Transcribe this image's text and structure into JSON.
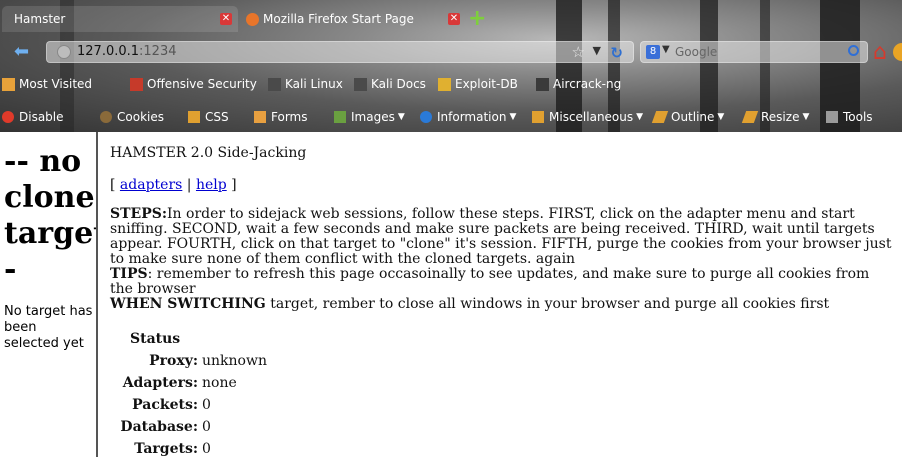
{
  "tabs": [
    {
      "label": "Hamster",
      "active": true
    },
    {
      "label": "Mozilla Firefox Start Page",
      "active": false
    }
  ],
  "navbar": {
    "url_host": "127.0.0.1",
    "url_port": ":1234",
    "search_placeholder": "Google"
  },
  "bookmarks": [
    {
      "label": "Most Visited",
      "icon": "folder-icon"
    },
    {
      "label": "Offensive Security",
      "icon": "offsec-icon"
    },
    {
      "label": "Kali Linux",
      "icon": "kali-icon"
    },
    {
      "label": "Kali Docs",
      "icon": "kali-icon"
    },
    {
      "label": "Exploit-DB",
      "icon": "exploitdb-icon"
    },
    {
      "label": "Aircrack-ng",
      "icon": "aircrack-icon"
    }
  ],
  "webdev_toolbar": [
    {
      "label": "Disable",
      "icon": "disable-icon"
    },
    {
      "label": "Cookies",
      "icon": "cookies-icon"
    },
    {
      "label": "CSS",
      "icon": "css-icon"
    },
    {
      "label": "Forms",
      "icon": "forms-icon"
    },
    {
      "label": "Images",
      "icon": "images-icon"
    },
    {
      "label": "Information",
      "icon": "information-icon"
    },
    {
      "label": "Miscellaneous",
      "icon": "miscellaneous-icon"
    },
    {
      "label": "Outline",
      "icon": "outline-icon"
    },
    {
      "label": "Resize",
      "icon": "resize-icon"
    },
    {
      "label": "Tools",
      "icon": "tools-icon"
    }
  ],
  "left_frame": {
    "title": "-- no clone target --",
    "message": "No target has been selected yet"
  },
  "main": {
    "title": "HAMSTER 2.0 Side-Jacking",
    "link_open": "[ ",
    "link_adapters": "adapters",
    "link_sep": " | ",
    "link_help": "help",
    "link_close": " ]",
    "steps_label": "STEPS:",
    "steps_text": "In order to sidejack web sessions, follow these steps. FIRST, click on the adapter menu and start sniffing. SECOND, wait a few seconds and make sure packets are being received. THIRD, wait until targets appear. FOURTH, click on that target to \"clone\" it's session. FIFTH, purge the cookies from your browser just to make sure none of them conflict with the cloned targets. again",
    "tips_label": "TIPS",
    "tips_text": ": remember to refresh this page occasoinally to see updates, and make sure to purge all cookies from the browser",
    "switch_label": "WHEN SWITCHING",
    "switch_text": " target, rember to close all windows in your browser and purge all cookies first"
  },
  "status": {
    "heading": "Status",
    "rows": [
      {
        "label": "Proxy:",
        "value": "unknown"
      },
      {
        "label": "Adapters:",
        "value": "none"
      },
      {
        "label": "Packets:",
        "value": "0"
      },
      {
        "label": "Database:",
        "value": "0"
      },
      {
        "label": "Targets:",
        "value": "0"
      }
    ]
  },
  "colors": {
    "link": "#0000d0",
    "tab_close": "#d93838"
  }
}
